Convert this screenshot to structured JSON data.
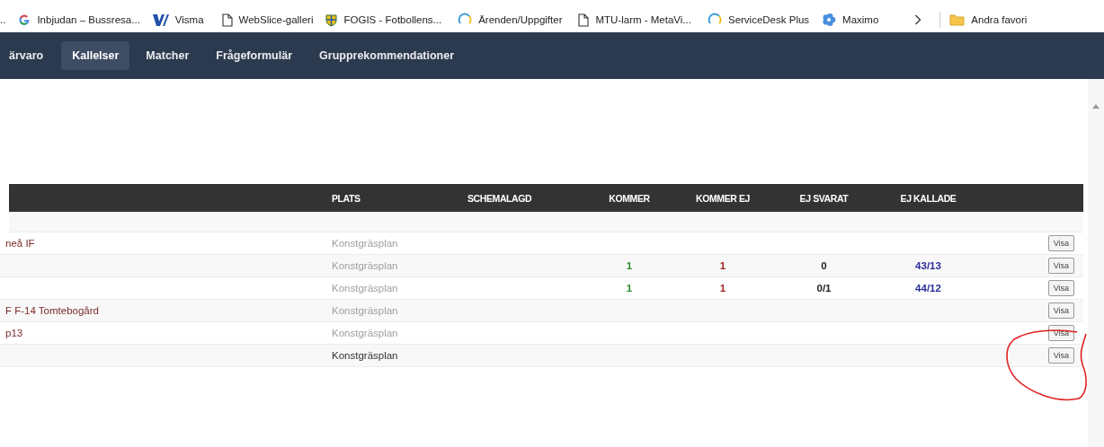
{
  "bookmarks": [
    {
      "kind": "ellipsis",
      "label": ".."
    },
    {
      "kind": "google",
      "label": "Inbjudan – Bussresa..."
    },
    {
      "kind": "visma",
      "label": "Visma"
    },
    {
      "kind": "page",
      "label": "WebSlice-galleri"
    },
    {
      "kind": "shield",
      "label": "FOGIS - Fotbollens..."
    },
    {
      "kind": "ring",
      "label": "Ärenden/Uppgifter"
    },
    {
      "kind": "page",
      "label": "MTU-larm - MetaVi..."
    },
    {
      "kind": "ring",
      "label": "ServiceDesk Plus"
    },
    {
      "kind": "flower",
      "label": "Maximo"
    },
    {
      "kind": "more"
    },
    {
      "kind": "folder",
      "label": "Andra favori"
    }
  ],
  "nav": [
    {
      "label": "ärvaro",
      "selected": false
    },
    {
      "label": "Kallelser",
      "selected": true
    },
    {
      "label": "Matcher",
      "selected": false
    },
    {
      "label": "Frågeformulär",
      "selected": false
    },
    {
      "label": "Grupprekommendationer",
      "selected": false
    }
  ],
  "table": {
    "columns": [
      "PLATS",
      "SCHEMALAGD",
      "KOMMER",
      "KOMMER EJ",
      "EJ SVARAT",
      "EJ KALLADE"
    ],
    "rows": [
      {
        "name": "neå IF",
        "plats": "Konstgräsplan",
        "muted": true,
        "kommer": "",
        "kommer_ej": "",
        "ej_svarat": "",
        "ej_kallade": "",
        "action": "Visa"
      },
      {
        "name": "",
        "plats": "Konstgräsplan",
        "muted": true,
        "kommer": "1",
        "kommer_ej": "1",
        "ej_svarat": "0",
        "ej_kallade": "43/13",
        "action": "Visa"
      },
      {
        "name": "",
        "plats": "Konstgräsplan",
        "muted": true,
        "kommer": "1",
        "kommer_ej": "1",
        "ej_svarat": "0/1",
        "ej_kallade": "44/12",
        "action": "Visa"
      },
      {
        "name": "F F-14 Tomtebogård",
        "plats": "Konstgräsplan",
        "muted": true,
        "kommer": "",
        "kommer_ej": "",
        "ej_svarat": "",
        "ej_kallade": "",
        "action": "Visa"
      },
      {
        "name": "p13",
        "plats": "Konstgräsplan",
        "muted": true,
        "kommer": "",
        "kommer_ej": "",
        "ej_svarat": "",
        "ej_kallade": "",
        "action": "Visa"
      },
      {
        "name": "",
        "plats": "Konstgräsplan",
        "muted": false,
        "kommer": "",
        "kommer_ej": "",
        "ej_svarat": "",
        "ej_kallade": "",
        "action": "Visa"
      }
    ]
  }
}
